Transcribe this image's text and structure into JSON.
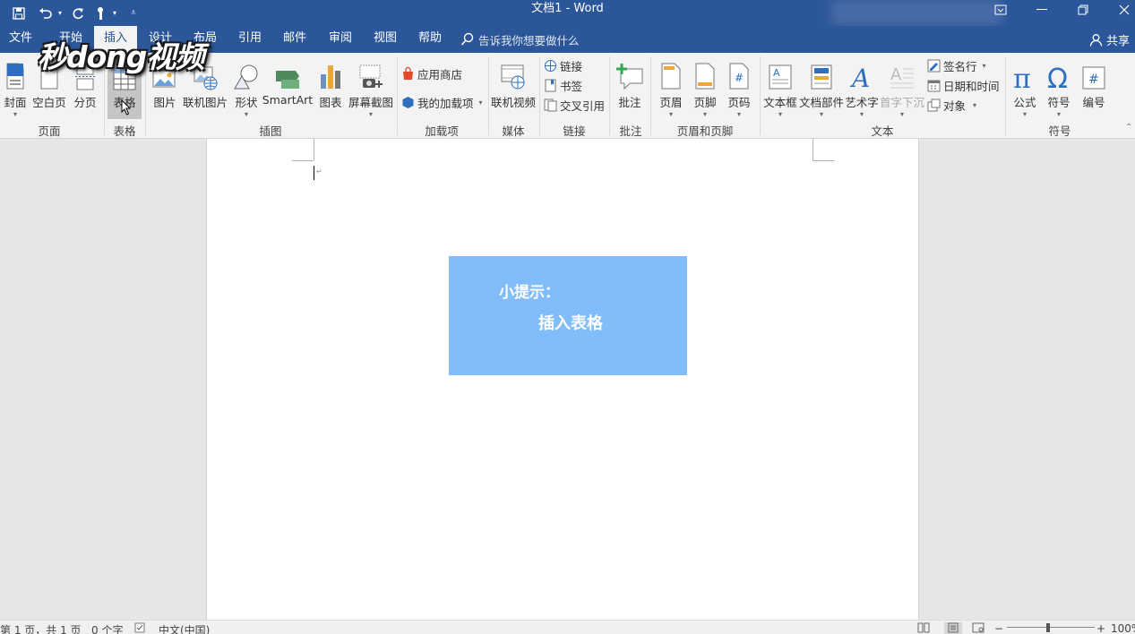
{
  "title": "文档1  -  Word",
  "tabs": [
    "文件",
    "开始",
    "插入",
    "设计",
    "布局",
    "引用",
    "邮件",
    "审阅",
    "视图",
    "帮助"
  ],
  "active_tab": "插入",
  "search_placeholder": "告诉我你想要做什么",
  "share_label": "共享",
  "ribbon": {
    "cover": "封面",
    "blank_page": "空白页",
    "page_break": "分页",
    "table": "表格",
    "picture": "图片",
    "online_picture": "联机图片",
    "shapes": "形状",
    "smartart": "SmartArt",
    "chart": "图表",
    "screenshot": "屏幕截图",
    "app_store": "应用商店",
    "my_addins": "我的加载项",
    "online_video": "联机视频",
    "link": "链接",
    "bookmark": "书签",
    "cross_ref": "交叉引用",
    "comment": "批注",
    "header": "页眉",
    "footer": "页脚",
    "page_number": "页码",
    "text_box": "文本框",
    "quick_parts": "文档部件",
    "wordart": "艺术字",
    "drop_cap": "首字下沉",
    "signature_line": "签名行",
    "date_time": "日期和时间",
    "object": "对象",
    "equation": "公式",
    "symbol": "符号",
    "number": "编号"
  },
  "groups": {
    "pages": "页面",
    "tables": "表格",
    "illustrations": "插图",
    "addins": "加载项",
    "media": "媒体",
    "links": "链接",
    "comments": "批注",
    "header_footer": "页眉和页脚",
    "text": "文本",
    "symbols": "符号"
  },
  "document": {
    "tip_title": "小提示：",
    "tip_text": "插入表格"
  },
  "status": {
    "page": "第 1 页，共 1 页",
    "words": "0 个字",
    "language": "中文(中国)",
    "zoom": "100%"
  },
  "watermark": "秒dong视频",
  "colors": {
    "title_bar": "#2b579a",
    "tip_box": "#82bdfb",
    "ribbon": "#f3f3f3"
  }
}
